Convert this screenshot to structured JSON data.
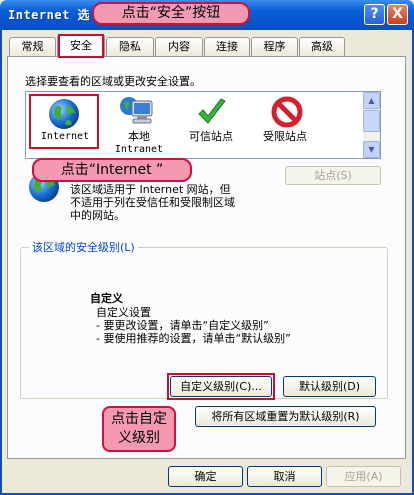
{
  "window": {
    "title": "Internet 选",
    "help": "?",
    "close": "X"
  },
  "annotations": {
    "security_tab": "点击“安全”按钮",
    "internet_zone": "点击“Internet ”",
    "custom_level_line1": "点击自定",
    "custom_level_line2": "义级别"
  },
  "tabs": [
    "常规",
    "安全",
    "隐私",
    "内容",
    "连接",
    "程序",
    "高级"
  ],
  "security": {
    "instruction": "选择要查看的区域或更改安全设置。",
    "zones": [
      {
        "label": "Internet",
        "icon": "globe-icon"
      },
      {
        "label": "本地\nIntranet",
        "icon": "local-intranet-icon"
      },
      {
        "label": "可信站点",
        "icon": "checkmark-icon"
      },
      {
        "label": "受限站点",
        "icon": "no-entry-icon"
      }
    ],
    "local_line1": "本地",
    "local_line2": "Intranet",
    "sites_button": "站点(S)",
    "zone_description_lines": [
      "该区域适用于 Internet 网站，但",
      "不适用于列在受信任和受限制区域",
      "中的网站。"
    ],
    "security_level_title": "该区域的安全级别(L)",
    "level_name": "自定义",
    "level_lines": [
      "自定义设置",
      "- 要更改设置，请单击“自定义级别”",
      "- 要使用推荐的设置，请单击“默认级别”"
    ],
    "custom_level_button": "自定义级别(C)...",
    "default_level_button": "默认级别(D)",
    "reset_all_button": "将所有区域重置为默认级别(R)"
  },
  "footer": {
    "ok": "确定",
    "cancel": "取消",
    "apply": "应用(A)"
  },
  "colors": {
    "titlebar": "#0654d0",
    "callout_fill": "#f39ab2",
    "callout_border": "#d0103e",
    "highlight": "#c8102e"
  }
}
